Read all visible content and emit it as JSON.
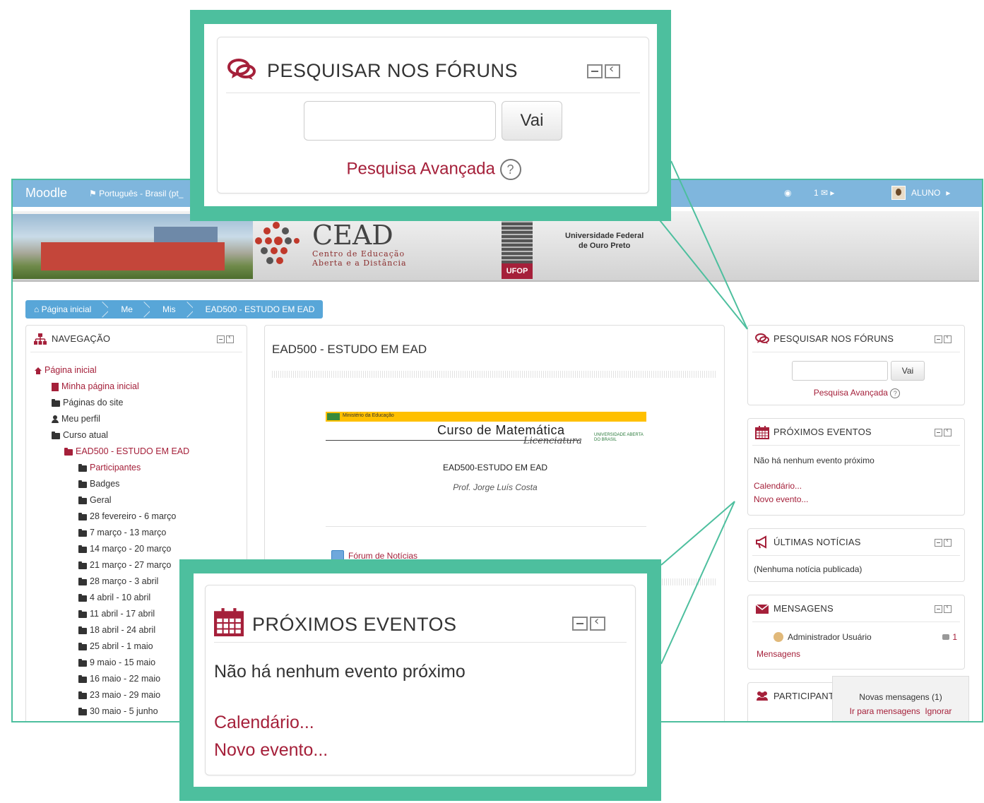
{
  "navbar": {
    "brand": "Moodle",
    "language": "Português - Brasil (pt_",
    "messages_count": "1",
    "user": "ALUNO"
  },
  "banner": {
    "cead_title": "CEAD",
    "cead_sub1": "Centro de Educação",
    "cead_sub2": "Aberta e a Distância",
    "ufop_tag": "UFOP",
    "univ1": "Universidade Federal",
    "univ2": "de Ouro Preto"
  },
  "breadcrumb": [
    "Página inicial",
    "Me",
    "Mis",
    "EAD500 - ESTUDO EM EAD"
  ],
  "navigation": {
    "title": "NAVEGAÇÃO",
    "home": "Página inicial",
    "my_home": "Minha página inicial",
    "site_pages": "Páginas do site",
    "profile": "Meu perfil",
    "current_course": "Curso atual",
    "course": "EAD500 - ESTUDO EM EAD",
    "items": [
      "Participantes",
      "Badges",
      "Geral",
      "28 fevereiro - 6 março",
      "7 março - 13 março",
      "14 março - 20 março",
      "21 março - 27 março",
      "28 março - 3 abril",
      "4 abril - 10 abril",
      "11 abril - 17 abril",
      "18 abril - 24 abril",
      "25 abril - 1 maio",
      "9 maio - 15 maio",
      "16 maio - 22 maio",
      "23 maio - 29 maio",
      "30 maio - 5 junho"
    ]
  },
  "course": {
    "title": "EAD500 - ESTUDO EM EAD",
    "ministry": "Ministério da Educação",
    "logo_title": "Curso de Matemática",
    "logo_sub": "Licenciatura",
    "uab": "UNIVERSIDADE ABERTA DO BRASIL",
    "code": "EAD500-ESTUDO EM EAD",
    "professor": "Prof. Jorge Luís Costa",
    "forum": "Fórum de Notícias"
  },
  "search": {
    "title": "PESQUISAR NOS FÓRUNS",
    "button": "Vai",
    "advanced": "Pesquisa Avançada",
    "help": "?"
  },
  "events": {
    "title": "PRÓXIMOS EVENTOS",
    "none": "Não há nenhum evento próximo",
    "calendar": "Calendário...",
    "new_event": "Novo evento..."
  },
  "news": {
    "title": "ÚLTIMAS NOTÍCIAS",
    "none": "(Nenhuma notícia publicada)"
  },
  "messages": {
    "title": "MENSAGENS",
    "sender": "Administrador Usuário",
    "count": "1",
    "link": "Mensagens"
  },
  "participants": {
    "title": "PARTICIPANT"
  },
  "notification": {
    "text": "Novas mensagens (1)",
    "go": "Ir para mensagens",
    "ignore": "Ignorar"
  },
  "colors": {
    "accent": "#4dbf9e",
    "link": "#a5203a",
    "navbar": "#7fb6dd",
    "breadcrumb": "#58a6d8"
  }
}
